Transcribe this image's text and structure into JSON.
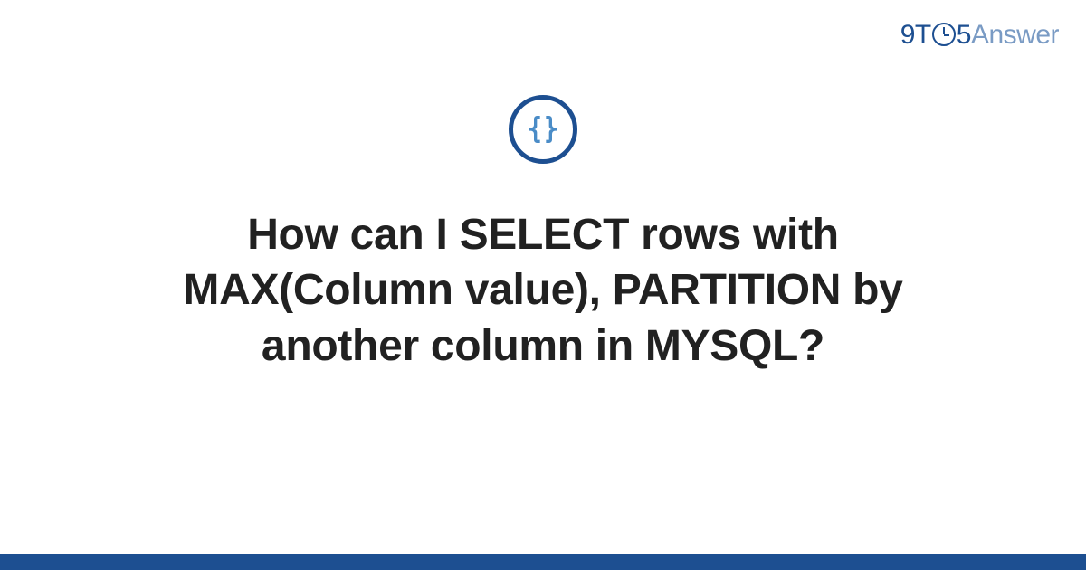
{
  "logo": {
    "part1": "9T",
    "part2": "5",
    "part3": "Answer"
  },
  "badge": {
    "icon_name": "code-braces-icon"
  },
  "title": "How can I SELECT rows with MAX(Column value), PARTITION by another column in MYSQL?",
  "colors": {
    "primary": "#1d4f91",
    "secondary": "#7a9bc4",
    "text": "#212121"
  }
}
